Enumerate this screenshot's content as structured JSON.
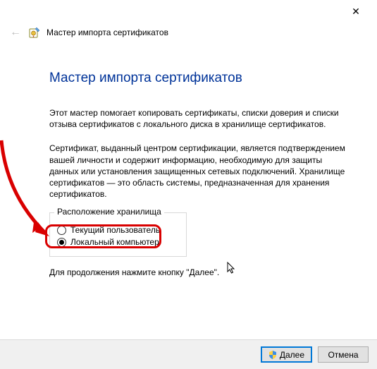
{
  "titlebar": {
    "close_label": "✕"
  },
  "header": {
    "back_glyph": "←",
    "wizard_title": "Мастер импорта сертификатов"
  },
  "main": {
    "heading": "Мастер импорта сертификатов",
    "para1": "Этот мастер помогает копировать сертификаты, списки доверия и списки отзыва сертификатов с локального диска в хранилище сертификатов.",
    "para2": "Сертификат, выданный центром сертификации, является подтверждением вашей личности и содержит информацию, необходимую для защиты данных или установления защищенных сетевых подключений. Хранилище сертификатов — это область системы, предназначенная для хранения сертификатов.",
    "group_legend": "Расположение хранилища",
    "radio_current_user": "Текущий пользователь",
    "radio_local_computer": "Локальный компьютер",
    "continue_text": "Для продолжения нажмите кнопку \"Далее\"."
  },
  "footer": {
    "next_label": "Далее",
    "cancel_label": "Отмена"
  },
  "state": {
    "selected_radio": "local_computer"
  }
}
